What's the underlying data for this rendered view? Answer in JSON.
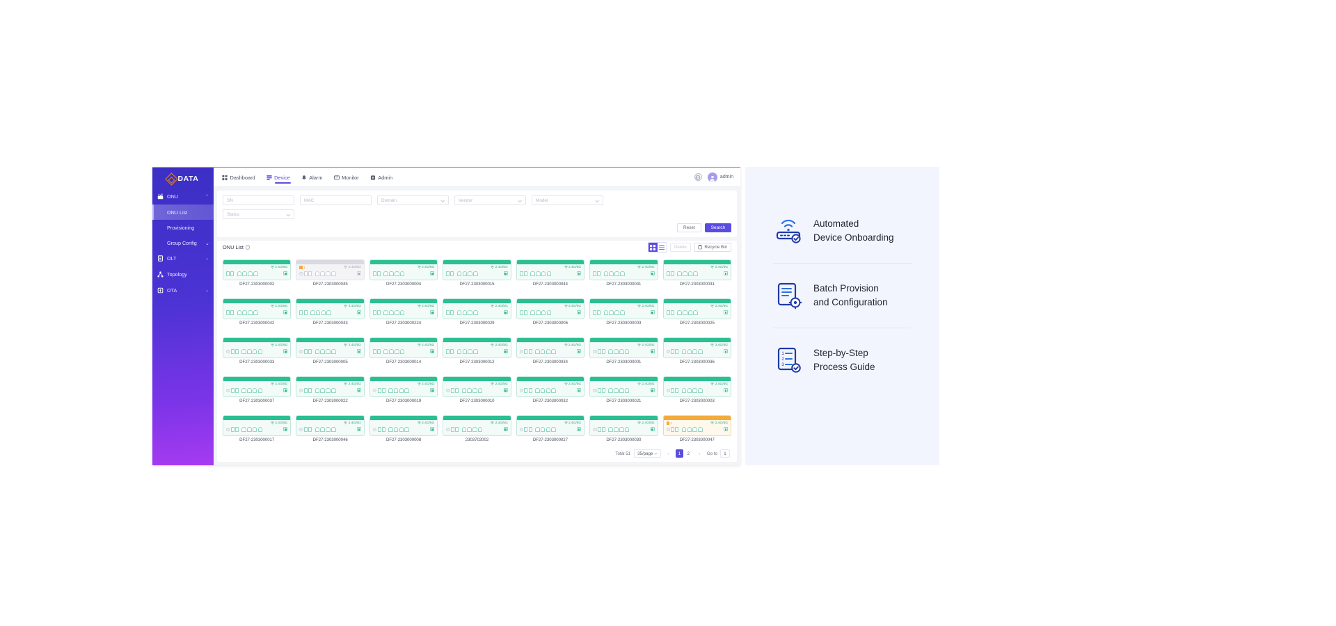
{
  "brand": {
    "name": "DATA",
    "logo_icon": "cdata-diamond-logo"
  },
  "sidebar": {
    "groups": [
      {
        "label": "ONU",
        "icon": "onu-device-icon",
        "expanded": true,
        "chevron": "chevron-up",
        "children": [
          {
            "label": "ONU List",
            "active": true
          },
          {
            "label": "Provisioning",
            "active": false
          },
          {
            "label": "Group Config",
            "active": false,
            "chevron": "chevron-down"
          }
        ]
      },
      {
        "label": "OLT",
        "icon": "olt-rack-icon",
        "expanded": false,
        "chevron": "chevron-down",
        "children": []
      },
      {
        "label": "Topology",
        "icon": "topology-icon",
        "expanded": false,
        "chevron": "",
        "children": []
      },
      {
        "label": "OTA",
        "icon": "ota-upgrade-icon",
        "expanded": false,
        "chevron": "chevron-down",
        "children": []
      }
    ]
  },
  "topnav": {
    "tabs": [
      {
        "label": "Dashboard",
        "icon": "dashboard-grid-icon",
        "active": false
      },
      {
        "label": "Device",
        "icon": "device-list-icon",
        "active": true
      },
      {
        "label": "Alarm",
        "icon": "alarm-bell-icon",
        "active": false
      },
      {
        "label": "Monitor",
        "icon": "monitor-screen-icon",
        "active": false
      },
      {
        "label": "Admin",
        "icon": "admin-shield-icon",
        "active": false
      }
    ],
    "language_icon": "globe-icon",
    "user": {
      "name": "admin",
      "avatar_icon": "user-avatar-icon"
    }
  },
  "filters": {
    "fields": [
      {
        "name": "sn",
        "placeholder": "SN",
        "value": "",
        "type": "input"
      },
      {
        "name": "mac",
        "placeholder": "MAC",
        "value": "",
        "type": "input"
      },
      {
        "name": "domain",
        "placeholder": "Domain",
        "value": "",
        "type": "select"
      },
      {
        "name": "vendor",
        "placeholder": "Vendor",
        "value": "",
        "type": "select"
      },
      {
        "name": "model",
        "placeholder": "Model",
        "value": "",
        "type": "select"
      },
      {
        "name": "status",
        "placeholder": "Status",
        "value": "",
        "type": "select"
      }
    ],
    "reset_label": "Reset",
    "search_label": "Search"
  },
  "list": {
    "title": "ONU List",
    "info_icon": "info-circle-icon",
    "view_modes": [
      {
        "name": "card-view",
        "icon": "grid-view-icon",
        "active": true
      },
      {
        "name": "table-view",
        "icon": "list-view-icon",
        "active": false
      }
    ],
    "delete_label": "Delete",
    "delete_enabled": false,
    "recycle_label": "Recycle Bin",
    "recycle_icon": "trash-icon"
  },
  "devices": [
    {
      "sn": "DF27-2303000002",
      "wifi": "2.4G/5G",
      "state": "online",
      "alarms": "",
      "has_pon": false,
      "sfp_ports": 2,
      "eth_ports": 4
    },
    {
      "sn": "DF27-2303000045",
      "wifi": "2.4G/5G",
      "state": "offline",
      "alarms": "1",
      "has_pon": true,
      "sfp_ports": 2,
      "eth_ports": 4
    },
    {
      "sn": "DF27-2303000004",
      "wifi": "2.4G/5G",
      "state": "online",
      "alarms": "",
      "has_pon": false,
      "sfp_ports": 2,
      "eth_ports": 4
    },
    {
      "sn": "DF27-2303000015",
      "wifi": "2.4G/5G",
      "state": "online",
      "alarms": "",
      "has_pon": false,
      "sfp_ports": 2,
      "eth_ports": 4
    },
    {
      "sn": "DF27-2303000044",
      "wifi": "2.4G/5G",
      "state": "online",
      "alarms": "",
      "has_pon": false,
      "sfp_ports": 2,
      "eth_ports": 4
    },
    {
      "sn": "DF27-2303000041",
      "wifi": "2.4G/5G",
      "state": "online",
      "alarms": "",
      "has_pon": false,
      "sfp_ports": 2,
      "eth_ports": 4
    },
    {
      "sn": "DF27-2303000031",
      "wifi": "2.4G/5G",
      "state": "online",
      "alarms": "",
      "has_pon": false,
      "sfp_ports": 2,
      "eth_ports": 4
    },
    {
      "sn": "DF27-2303000042",
      "wifi": "2.4G/5G",
      "state": "online",
      "alarms": "",
      "has_pon": false,
      "sfp_ports": 2,
      "eth_ports": 4
    },
    {
      "sn": "DF27-2303000043",
      "wifi": "2.4G/5G",
      "state": "online",
      "alarms": "",
      "has_pon": false,
      "sfp_ports": 2,
      "eth_ports": 4
    },
    {
      "sn": "DF27-2303000224",
      "wifi": "2.4G/5G",
      "state": "online",
      "alarms": "",
      "has_pon": false,
      "sfp_ports": 2,
      "eth_ports": 4
    },
    {
      "sn": "DF27-2303000029",
      "wifi": "2.4G/5G",
      "state": "online",
      "alarms": "",
      "has_pon": false,
      "sfp_ports": 2,
      "eth_ports": 4
    },
    {
      "sn": "DF27-2303000006",
      "wifi": "2.4G/5G",
      "state": "online",
      "alarms": "",
      "has_pon": false,
      "sfp_ports": 2,
      "eth_ports": 4
    },
    {
      "sn": "DF27-2303000003",
      "wifi": "2.4G/5G",
      "state": "online",
      "alarms": "",
      "has_pon": false,
      "sfp_ports": 2,
      "eth_ports": 4
    },
    {
      "sn": "DF27-2303000025",
      "wifi": "2.4G/5G",
      "state": "online",
      "alarms": "",
      "has_pon": false,
      "sfp_ports": 2,
      "eth_ports": 4
    },
    {
      "sn": "DF27-2303000033",
      "wifi": "2.4G/5G",
      "state": "online",
      "alarms": "",
      "has_pon": true,
      "sfp_ports": 2,
      "eth_ports": 4
    },
    {
      "sn": "DF27-2303000005",
      "wifi": "2.4G/5G",
      "state": "online",
      "alarms": "",
      "has_pon": true,
      "sfp_ports": 2,
      "eth_ports": 4
    },
    {
      "sn": "DF27-2303000014",
      "wifi": "2.4G/5G",
      "state": "online",
      "alarms": "",
      "has_pon": false,
      "sfp_ports": 2,
      "eth_ports": 4
    },
    {
      "sn": "DF27-2303000012",
      "wifi": "2.4G/5G",
      "state": "online",
      "alarms": "",
      "has_pon": false,
      "sfp_ports": 2,
      "eth_ports": 4
    },
    {
      "sn": "DF27-2303000034",
      "wifi": "2.4G/5G",
      "state": "online",
      "alarms": "",
      "has_pon": true,
      "sfp_ports": 2,
      "eth_ports": 4
    },
    {
      "sn": "DF27-2303000001",
      "wifi": "2.4G/5G",
      "state": "online",
      "alarms": "",
      "has_pon": true,
      "sfp_ports": 2,
      "eth_ports": 4
    },
    {
      "sn": "DF27-2303000036",
      "wifi": "2.4G/5G",
      "state": "online",
      "alarms": "",
      "has_pon": true,
      "sfp_ports": 2,
      "eth_ports": 4
    },
    {
      "sn": "DF27-2303000037",
      "wifi": "2.4G/5G",
      "state": "online",
      "alarms": "",
      "has_pon": true,
      "sfp_ports": 2,
      "eth_ports": 4
    },
    {
      "sn": "DF27-2303000022",
      "wifi": "2.4G/5G",
      "state": "online",
      "alarms": "",
      "has_pon": true,
      "sfp_ports": 2,
      "eth_ports": 4
    },
    {
      "sn": "DF27-2303000019",
      "wifi": "2.4G/5G",
      "state": "online",
      "alarms": "",
      "has_pon": true,
      "sfp_ports": 2,
      "eth_ports": 4
    },
    {
      "sn": "DF27-2303000010",
      "wifi": "2.4G/5G",
      "state": "online",
      "alarms": "",
      "has_pon": true,
      "sfp_ports": 2,
      "eth_ports": 4
    },
    {
      "sn": "DF27-2303000032",
      "wifi": "2.4G/5G",
      "state": "online",
      "alarms": "",
      "has_pon": true,
      "sfp_ports": 2,
      "eth_ports": 4
    },
    {
      "sn": "DF27-2303000021",
      "wifi": "2.4G/5G",
      "state": "online",
      "alarms": "",
      "has_pon": true,
      "sfp_ports": 2,
      "eth_ports": 4
    },
    {
      "sn": "DF27-2303000003",
      "wifi": "2.4G/5G",
      "state": "online",
      "alarms": "",
      "has_pon": true,
      "sfp_ports": 2,
      "eth_ports": 4
    },
    {
      "sn": "DF27-2303000017",
      "wifi": "2.4G/5G",
      "state": "online",
      "alarms": "",
      "has_pon": true,
      "sfp_ports": 2,
      "eth_ports": 4
    },
    {
      "sn": "DF27-2303000046",
      "wifi": "2.4G/5G",
      "state": "online",
      "alarms": "",
      "has_pon": true,
      "sfp_ports": 2,
      "eth_ports": 4
    },
    {
      "sn": "DF27-2303000008",
      "wifi": "2.4G/5G",
      "state": "online",
      "alarms": "",
      "has_pon": true,
      "sfp_ports": 2,
      "eth_ports": 4
    },
    {
      "sn": "2303702002",
      "wifi": "2.4G/5G",
      "state": "online",
      "alarms": "",
      "has_pon": true,
      "sfp_ports": 2,
      "eth_ports": 4
    },
    {
      "sn": "DF27-2303000027",
      "wifi": "2.4G/5G",
      "state": "online",
      "alarms": "",
      "has_pon": true,
      "sfp_ports": 2,
      "eth_ports": 4
    },
    {
      "sn": "DF27-2303000030",
      "wifi": "2.4G/5G",
      "state": "online",
      "alarms": "",
      "has_pon": true,
      "sfp_ports": 2,
      "eth_ports": 4
    },
    {
      "sn": "DF27-2303000047",
      "wifi": "2.4G/5G",
      "state": "warn",
      "alarms": "1",
      "has_pon": true,
      "sfp_ports": 2,
      "eth_ports": 4
    }
  ],
  "pagination": {
    "total_label": "Total 51",
    "page_size": "35/page",
    "prev_icon": "chevron-left-icon",
    "next_icon": "chevron-right-icon",
    "pages": [
      "1",
      "2"
    ],
    "current_page": "1",
    "goto_label": "Go to",
    "goto_value": "1"
  },
  "features": [
    {
      "icon": "router-wifi-icon",
      "text": "Automated\nDevice Onboarding"
    },
    {
      "icon": "batch-config-gear-icon",
      "text": "Batch Provision\nand Configuration"
    },
    {
      "icon": "steps-checklist-icon",
      "text": "Step-by-Step\nProcess Guide"
    }
  ],
  "colors": {
    "brand_purple": "#5b4ce0",
    "sidebar_from": "#3b2fc4",
    "sidebar_to": "#a63bf0",
    "accent_orange": "#e8821e",
    "online_green": "#2bbf92",
    "warn_orange": "#f3ab3c",
    "top_border_cyan": "#29c6d8",
    "feature_bg": "#f2f5fd",
    "icon_blue": "#1f3aa8"
  }
}
